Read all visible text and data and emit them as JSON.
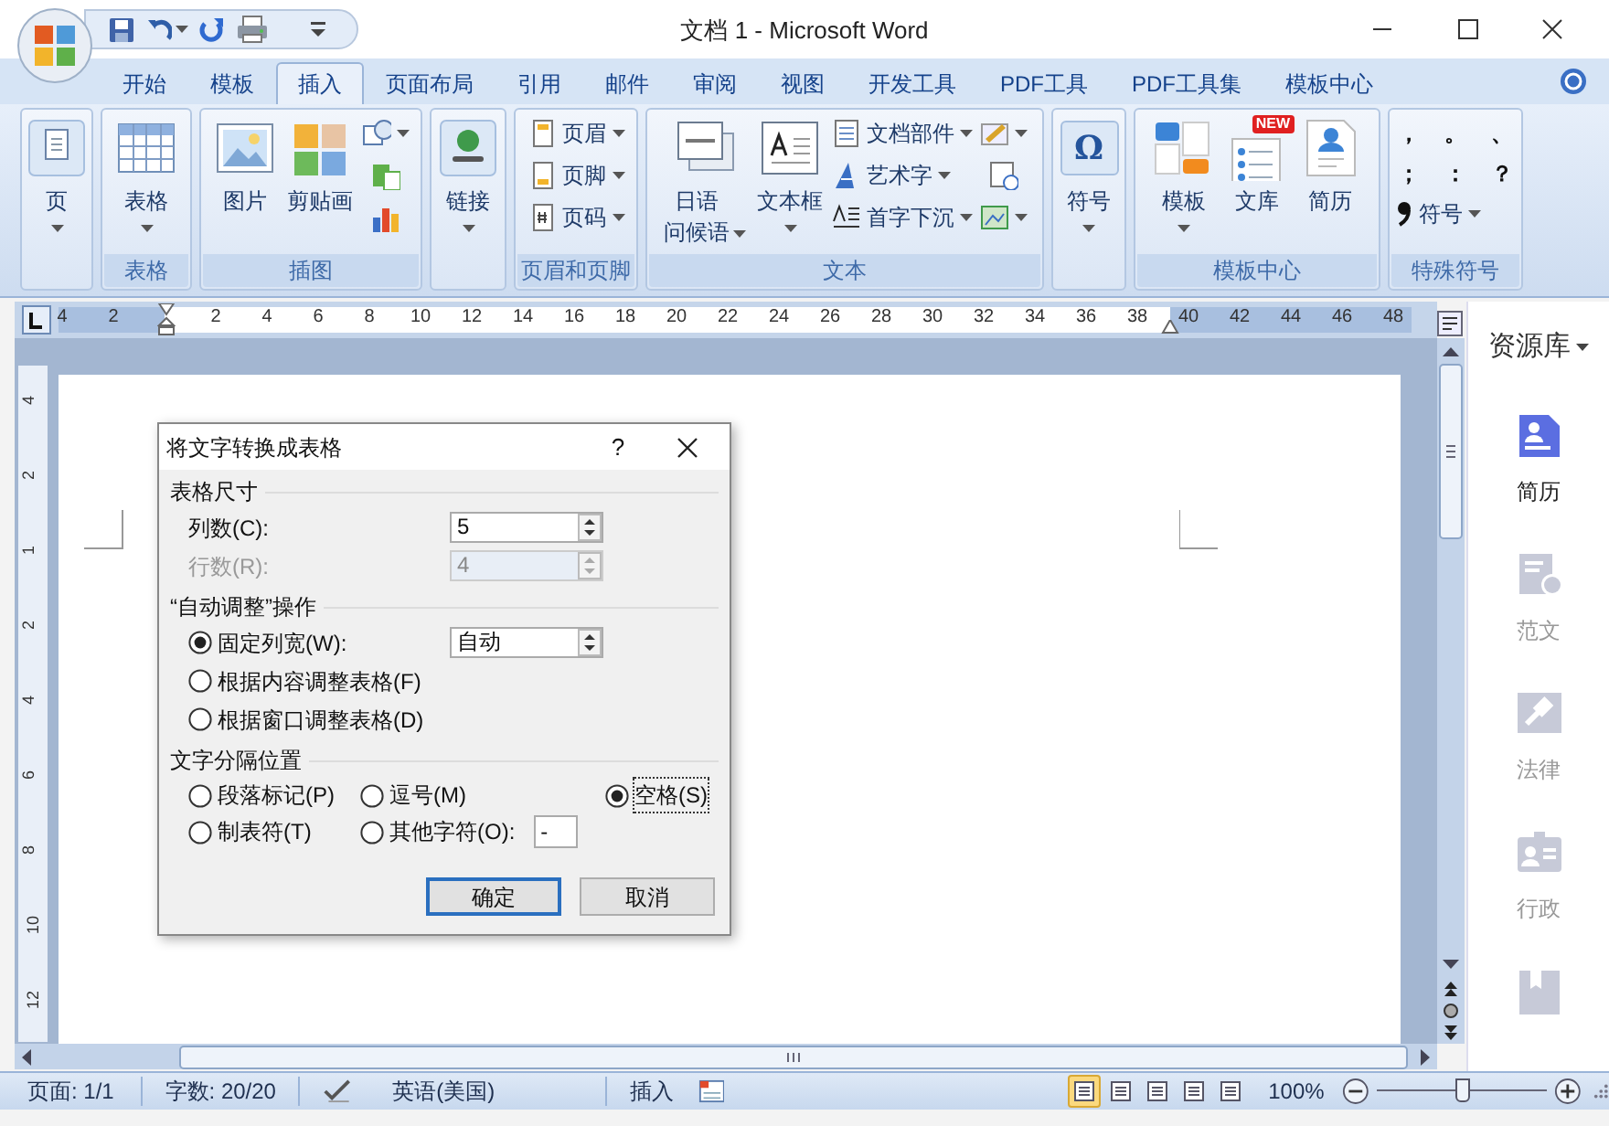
{
  "window": {
    "title": "文档 1 - Microsoft Word"
  },
  "tabs": [
    {
      "label": "开始",
      "selected": false
    },
    {
      "label": "模板",
      "selected": false
    },
    {
      "label": "插入",
      "selected": true
    },
    {
      "label": "页面布局",
      "selected": false
    },
    {
      "label": "引用",
      "selected": false
    },
    {
      "label": "邮件",
      "selected": false
    },
    {
      "label": "审阅",
      "selected": false
    },
    {
      "label": "视图",
      "selected": false
    },
    {
      "label": "开发工具",
      "selected": false
    },
    {
      "label": "PDF工具",
      "selected": false
    },
    {
      "label": "PDF工具集",
      "selected": false
    },
    {
      "label": "模板中心",
      "selected": false
    }
  ],
  "ribbon": [
    {
      "items": [
        {
          "kind": "large",
          "label": "页",
          "dropdown": true
        }
      ]
    },
    {
      "label": "表格",
      "items": [
        {
          "kind": "large",
          "label": "表格",
          "dropdown": true
        }
      ]
    },
    {
      "label": "插图",
      "items": [
        {
          "kind": "large",
          "label": "图片",
          "dropdown": false
        },
        {
          "kind": "large",
          "label": "剪贴画",
          "dropdown": false
        },
        {
          "kind": "icon",
          "dropdown": true
        },
        {
          "kind": "icon",
          "dropdown": false
        },
        {
          "kind": "icon",
          "dropdown": false
        }
      ]
    },
    {
      "items": [
        {
          "kind": "large",
          "label": "链接",
          "dropdown": true
        }
      ]
    },
    {
      "label": "页眉和页脚",
      "items": [
        {
          "kind": "small",
          "label": "页眉",
          "dropdown": true
        },
        {
          "kind": "small",
          "label": "页脚",
          "dropdown": true
        },
        {
          "kind": "small",
          "label": "页码",
          "dropdown": true
        }
      ]
    },
    {
      "label": "文本",
      "items": [
        {
          "kind": "large",
          "lines": [
            "日语",
            "问候语"
          ],
          "dropdown": true
        },
        {
          "kind": "large",
          "label": "文本框",
          "dropdown": true
        },
        {
          "kind": "small",
          "label": "文档部件",
          "dropdown": true
        },
        {
          "kind": "small",
          "label": "艺术字",
          "dropdown": true
        },
        {
          "kind": "small",
          "label": "首字下沉",
          "dropdown": true
        },
        {
          "kind": "icon",
          "dropdown": true
        },
        {
          "kind": "icon",
          "dropdown": false
        },
        {
          "kind": "icon",
          "dropdown": true
        }
      ]
    },
    {
      "items": [
        {
          "kind": "large",
          "label": "符号",
          "glyph": "Ω",
          "dropdown": true
        }
      ]
    },
    {
      "label": "模板中心",
      "items": [
        {
          "kind": "large",
          "label": "模板",
          "dropdown": true
        },
        {
          "kind": "large",
          "label": "文库",
          "badge": "NEW",
          "dropdown": false
        },
        {
          "kind": "large",
          "label": "简历",
          "dropdown": false
        }
      ]
    },
    {
      "label": "特殊符号",
      "items": [
        {
          "kind": "char",
          "label": "，"
        },
        {
          "kind": "char",
          "label": "。"
        },
        {
          "kind": "char",
          "label": "、"
        },
        {
          "kind": "char",
          "label": "；"
        },
        {
          "kind": "char",
          "label": "："
        },
        {
          "kind": "char",
          "label": "？"
        },
        {
          "kind": "small",
          "label": "符号",
          "dropdown": true
        }
      ]
    }
  ],
  "ruler": {
    "left_marks": [
      "4",
      "2"
    ],
    "marks": [
      "2",
      "4",
      "6",
      "8",
      "10",
      "12",
      "14",
      "16",
      "18",
      "20",
      "22",
      "24",
      "26",
      "28",
      "30",
      "32",
      "34",
      "36",
      "38",
      "40",
      "42",
      "44",
      "46",
      "48"
    ]
  },
  "vertical_ruler": {
    "marks": [
      "4",
      "2",
      "1",
      "2",
      "4",
      "6",
      "8",
      "10",
      "12"
    ]
  },
  "dialog": {
    "title": "将文字转换成表格",
    "help": "?",
    "table_size": {
      "heading": "表格尺寸",
      "fields": [
        {
          "label": "列数(C):",
          "value": "5",
          "disabled": false
        },
        {
          "label": "行数(R):",
          "value": "4",
          "disabled": true
        }
      ]
    },
    "autofit": {
      "heading": "“自动调整”操作",
      "options": [
        {
          "label": "固定列宽(W):",
          "selected": true,
          "value": "自动"
        },
        {
          "label": "根据内容调整表格(F)",
          "selected": false
        },
        {
          "label": "根据窗口调整表格(D)",
          "selected": false
        }
      ]
    },
    "separator": {
      "heading": "文字分隔位置",
      "options": [
        {
          "label": "段落标记(P)",
          "selected": false
        },
        {
          "label": "逗号(M)",
          "selected": false
        },
        {
          "label": "空格(S)",
          "selected": true
        },
        {
          "label": "制表符(T)",
          "selected": false
        },
        {
          "label": "其他字符(O):",
          "selected": false,
          "value": "-"
        }
      ]
    },
    "buttons": [
      {
        "label": "确定",
        "default": true
      },
      {
        "label": "取消",
        "default": false
      }
    ]
  },
  "side_panel": {
    "title": "资源库",
    "items": [
      {
        "label": "简历",
        "selected": true
      },
      {
        "label": "范文",
        "selected": false
      },
      {
        "label": "法律",
        "selected": false
      },
      {
        "label": "行政",
        "selected": false
      },
      {
        "selected": false
      }
    ]
  },
  "status_bar": {
    "page": "页面: 1/1",
    "words": "字数: 20/20",
    "language": "英语(美国)",
    "mode": "插入",
    "views": [
      {
        "selected": true
      },
      {
        "selected": false
      },
      {
        "selected": false
      },
      {
        "selected": false
      },
      {
        "selected": false
      }
    ],
    "zoom": "100%",
    "zoom_level": {
      "level": 0.5
    }
  }
}
